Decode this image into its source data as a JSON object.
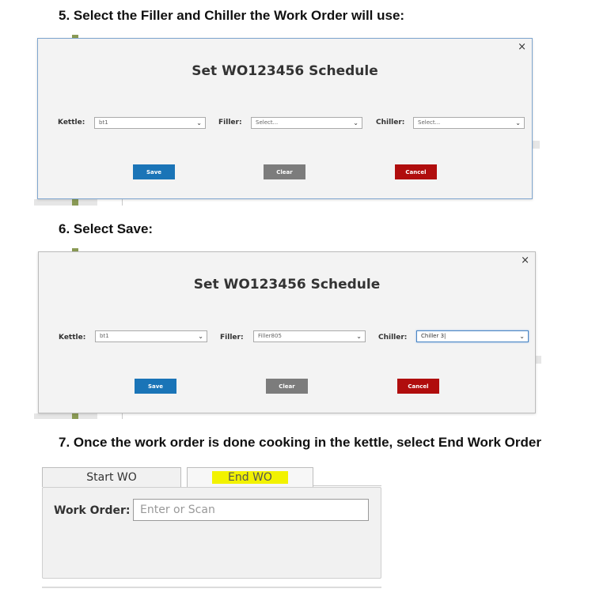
{
  "steps": {
    "step5": "5.   Select the Filler and Chiller the Work Order will use:",
    "step6": "6.   Select Save:",
    "step7": "7.   Once the work order is done cooking in the kettle, select End Work Order"
  },
  "dialog1": {
    "close": "×",
    "title": "Set WO123456 Schedule",
    "kettle_label": "Kettle:",
    "kettle_value": "bt1",
    "filler_label": "Filler:",
    "filler_value": "Select...",
    "chiller_label": "Chiller:",
    "chiller_value": "Select...",
    "save": "Save",
    "clear": "Clear",
    "cancel": "Cancel"
  },
  "dialog2": {
    "close": "×",
    "title": "Set WO123456 Schedule",
    "kettle_label": "Kettle:",
    "kettle_value": "bt1",
    "filler_label": "Filler:",
    "filler_value": "Filler805",
    "chiller_label": "Chiller:",
    "chiller_value": "Chiller 3",
    "save": "Save",
    "clear": "Clear",
    "cancel": "Cancel"
  },
  "wo": {
    "tab_start": "Start WO",
    "tab_end": "End WO",
    "label": "Work Order:",
    "placeholder": "Enter or Scan"
  },
  "icons": {
    "chevron": "chevron-down-icon",
    "close": "close-icon"
  },
  "colors": {
    "save": "#1a74b7",
    "clear": "#7c7c7c",
    "cancel": "#b00d0d",
    "highlight": "#f2f200"
  }
}
